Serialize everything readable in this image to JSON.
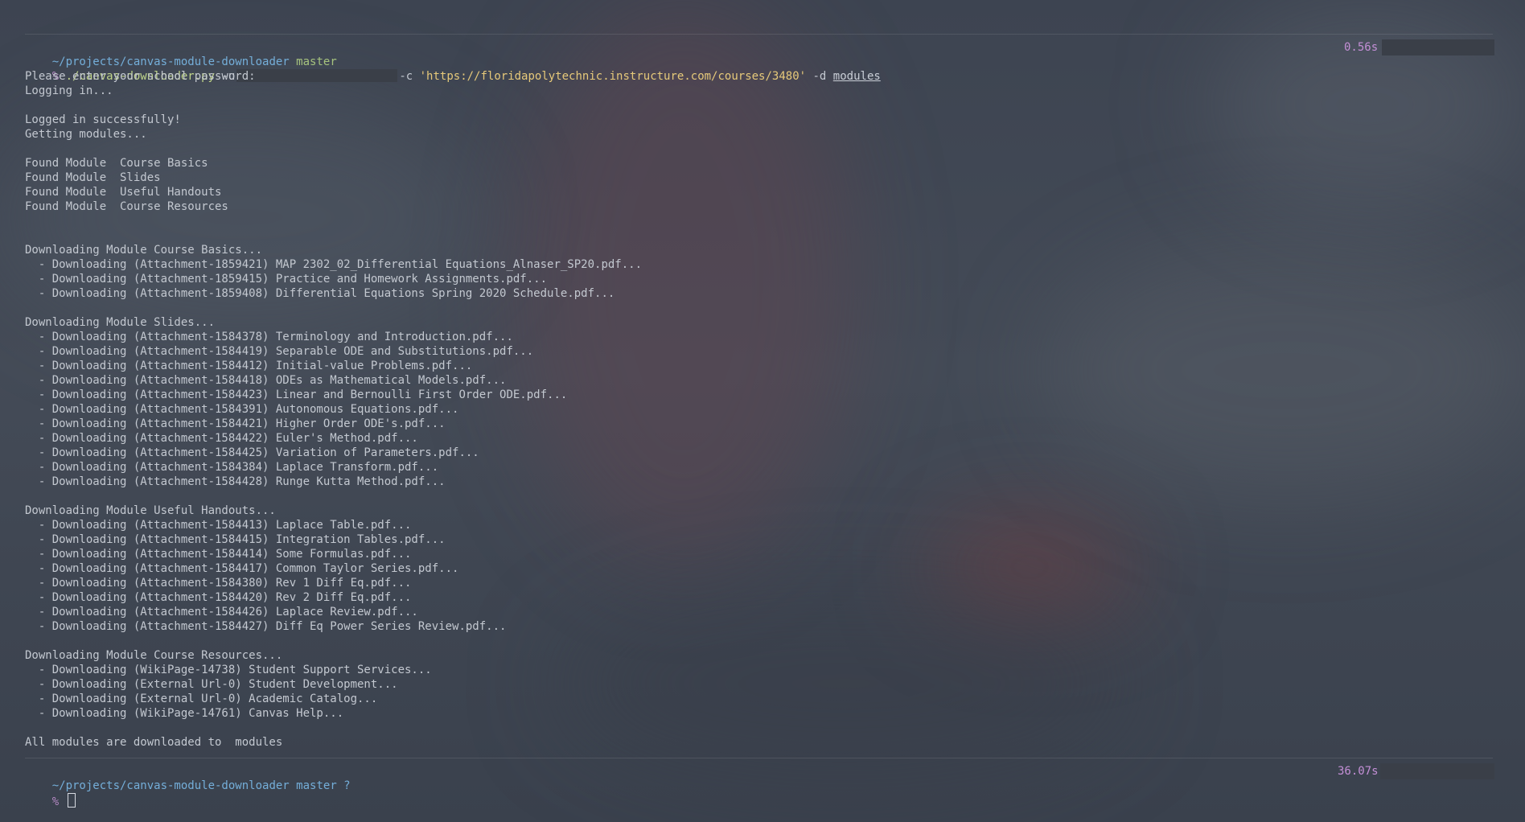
{
  "first_prompt": {
    "path": "~/projects/canvas-module-downloader",
    "branch": "master",
    "time": "0.56s"
  },
  "command": {
    "prompt_char": "%",
    "program": "./canvas-downloader.py",
    "user_flag": "-u",
    "course_flag": "-c",
    "course_url": "'https://floridapolytechnic.instructure.com/courses/3480'",
    "dir_flag": "-d",
    "dir_value": "modules"
  },
  "output_lines": [
    "Please enter your school password:",
    "Logging in...",
    "",
    "Logged in successfully!",
    "Getting modules...",
    "",
    "Found Module  Course Basics",
    "Found Module  Slides",
    "Found Module  Useful Handouts",
    "Found Module  Course Resources",
    "",
    "",
    "Downloading Module Course Basics...",
    "  - Downloading (Attachment-1859421) MAP 2302_02_Differential Equations_Alnaser_SP20.pdf...",
    "  - Downloading (Attachment-1859415) Practice and Homework Assignments.pdf...",
    "  - Downloading (Attachment-1859408) Differential Equations Spring 2020 Schedule.pdf...",
    "",
    "Downloading Module Slides...",
    "  - Downloading (Attachment-1584378) Terminology and Introduction.pdf...",
    "  - Downloading (Attachment-1584419) Separable ODE and Substitutions.pdf...",
    "  - Downloading (Attachment-1584412) Initial-value Problems.pdf...",
    "  - Downloading (Attachment-1584418) ODEs as Mathematical Models.pdf...",
    "  - Downloading (Attachment-1584423) Linear and Bernoulli First Order ODE.pdf...",
    "  - Downloading (Attachment-1584391) Autonomous Equations.pdf...",
    "  - Downloading (Attachment-1584421) Higher Order ODE's.pdf...",
    "  - Downloading (Attachment-1584422) Euler's Method.pdf...",
    "  - Downloading (Attachment-1584425) Variation of Parameters.pdf...",
    "  - Downloading (Attachment-1584384) Laplace Transform.pdf...",
    "  - Downloading (Attachment-1584428) Runge Kutta Method.pdf...",
    "",
    "Downloading Module Useful Handouts...",
    "  - Downloading (Attachment-1584413) Laplace Table.pdf...",
    "  - Downloading (Attachment-1584415) Integration Tables.pdf...",
    "  - Downloading (Attachment-1584414) Some Formulas.pdf...",
    "  - Downloading (Attachment-1584417) Common Taylor Series.pdf...",
    "  - Downloading (Attachment-1584380) Rev 1 Diff Eq.pdf...",
    "  - Downloading (Attachment-1584420) Rev 2 Diff Eq.pdf...",
    "  - Downloading (Attachment-1584426) Laplace Review.pdf...",
    "  - Downloading (Attachment-1584427) Diff Eq Power Series Review.pdf...",
    "",
    "Downloading Module Course Resources...",
    "  - Downloading (WikiPage-14738) Student Support Services...",
    "  - Downloading (External Url-0) Student Development...",
    "  - Downloading (External Url-0) Academic Catalog...",
    "  - Downloading (WikiPage-14761) Canvas Help...",
    "",
    "All modules are downloaded to  modules"
  ],
  "second_prompt": {
    "path": "~/projects/canvas-module-downloader",
    "branch": "master ?",
    "time": "36.07s",
    "prompt_char": "%"
  },
  "colors": {
    "path": "#74aed9",
    "branch": "#a6c37e",
    "string": "#e6c97a",
    "time": "#c48fd6",
    "text": "#c9ced6"
  }
}
